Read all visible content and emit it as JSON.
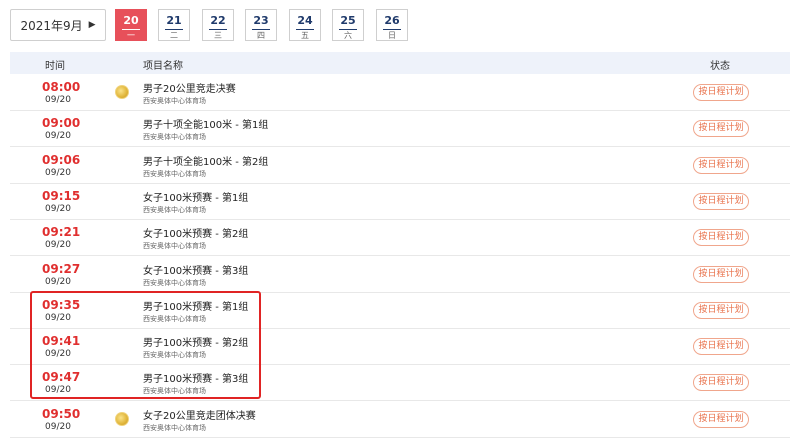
{
  "month_selector": {
    "label": "2021年9月"
  },
  "days": [
    {
      "num": "20",
      "weekday": "一",
      "active": true
    },
    {
      "num": "21",
      "weekday": "二",
      "active": false
    },
    {
      "num": "22",
      "weekday": "三",
      "active": false
    },
    {
      "num": "23",
      "weekday": "四",
      "active": false
    },
    {
      "num": "24",
      "weekday": "五",
      "active": false
    },
    {
      "num": "25",
      "weekday": "六",
      "active": false
    },
    {
      "num": "26",
      "weekday": "日",
      "active": false
    }
  ],
  "table": {
    "headers": {
      "time": "时间",
      "event": "项目名称",
      "status": "状态"
    },
    "rows": [
      {
        "time": "08:00",
        "date": "09/20",
        "name": "男子20公里竞走决赛",
        "venue": "西安奥体中心体育场",
        "medal": true,
        "action": "按日程计划"
      },
      {
        "time": "09:00",
        "date": "09/20",
        "name": "男子十项全能100米 - 第1组",
        "venue": "西安奥体中心体育场",
        "medal": false,
        "action": "按日程计划"
      },
      {
        "time": "09:06",
        "date": "09/20",
        "name": "男子十项全能100米 - 第2组",
        "venue": "西安奥体中心体育场",
        "medal": false,
        "action": "按日程计划"
      },
      {
        "time": "09:15",
        "date": "09/20",
        "name": "女子100米预赛 - 第1组",
        "venue": "西安奥体中心体育场",
        "medal": false,
        "action": "按日程计划"
      },
      {
        "time": "09:21",
        "date": "09/20",
        "name": "女子100米预赛 - 第2组",
        "venue": "西安奥体中心体育场",
        "medal": false,
        "action": "按日程计划"
      },
      {
        "time": "09:27",
        "date": "09/20",
        "name": "女子100米预赛 - 第3组",
        "venue": "西安奥体中心体育场",
        "medal": false,
        "action": "按日程计划"
      },
      {
        "time": "09:35",
        "date": "09/20",
        "name": "男子100米预赛 - 第1组",
        "venue": "西安奥体中心体育场",
        "medal": false,
        "action": "按日程计划"
      },
      {
        "time": "09:41",
        "date": "09/20",
        "name": "男子100米预赛 - 第2组",
        "venue": "西安奥体中心体育场",
        "medal": false,
        "action": "按日程计划"
      },
      {
        "time": "09:47",
        "date": "09/20",
        "name": "男子100米预赛 - 第3组",
        "venue": "西安奥体中心体育场",
        "medal": false,
        "action": "按日程计划"
      },
      {
        "time": "09:50",
        "date": "09/20",
        "name": "女子20公里竞走团体决赛",
        "venue": "西安奥体中心体育场",
        "medal": true,
        "action": "按日程计划"
      }
    ]
  },
  "colors": {
    "accent": "#e7505a",
    "time_red": "#e02f2f",
    "plan_orange": "#e9744e",
    "highlight_red": "#e02424"
  }
}
